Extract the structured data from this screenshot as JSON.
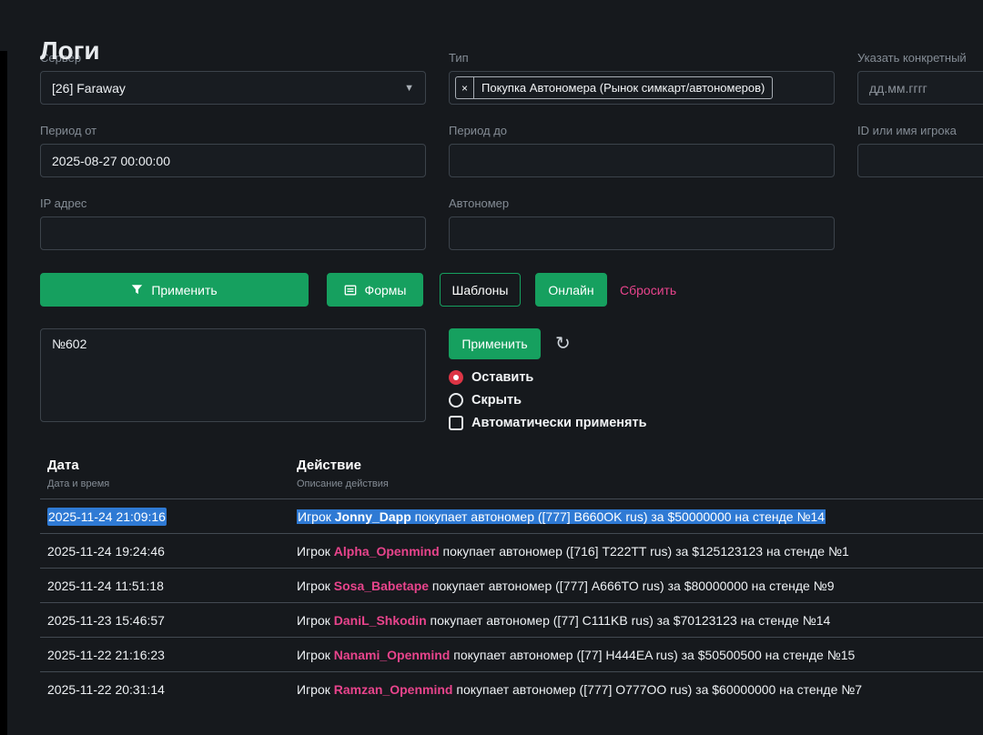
{
  "colors": {
    "accent_green": "#16a05f",
    "accent_pink": "#e8448c",
    "selection_blue": "#2f7ad4",
    "radio_red": "#dd3545"
  },
  "page": {
    "title": "Логи"
  },
  "filters": {
    "server": {
      "label": "Сервер",
      "value": "[26] Faraway"
    },
    "type": {
      "label": "Тип",
      "tag": "Покупка Автономера (Рынок симкарт/автономеров)",
      "tag_remove": "×"
    },
    "specific": {
      "label": "Указать конкретный",
      "placeholder": "дд.мм.гггг"
    },
    "period_from": {
      "label": "Период от",
      "value": "2025-08-27 00:00:00"
    },
    "period_to": {
      "label": "Период до",
      "value": ""
    },
    "player_id": {
      "label": "ID или имя игрока",
      "value": ""
    },
    "ip": {
      "label": "IP адрес",
      "value": ""
    },
    "autonumber": {
      "label": "Автономер",
      "value": ""
    }
  },
  "toolbar": {
    "apply_label": "Применить",
    "forms_label": "Формы",
    "templates_label": "Шаблоны",
    "online_label": "Онлайн",
    "reset_label": "Сбросить"
  },
  "note": {
    "text": "№602",
    "apply_label": "Применить",
    "refresh_icon": "↻",
    "options": [
      {
        "label": "Оставить",
        "type": "radio",
        "checked": true
      },
      {
        "label": "Скрыть",
        "type": "radio",
        "checked": false
      },
      {
        "label": "Автоматически применять",
        "type": "checkbox",
        "checked": false
      }
    ]
  },
  "table": {
    "columns": [
      {
        "title": "Дата",
        "subtitle": "Дата и время"
      },
      {
        "title": "Действие",
        "subtitle": "Описание действия"
      }
    ],
    "rows": [
      {
        "date": "2025-11-24 21:09:16",
        "prefix": "Игрок ",
        "player": "Jonny_Dapp",
        "action": " покупает автономер ([777] B660OK rus) за $50000000 на стенде №14",
        "selected": true
      },
      {
        "date": "2025-11-24 19:24:46",
        "prefix": "Игрок ",
        "player": "Alpha_Openmind",
        "action": " покупает автономер ([716] T222TT rus) за $125123123 на стенде №1"
      },
      {
        "date": "2025-11-24 11:51:18",
        "prefix": "Игрок ",
        "player": "Sosa_Babetape",
        "action": " покупает автономер ([777] A666TO rus) за $80000000 на стенде №9"
      },
      {
        "date": "2025-11-23 15:46:57",
        "prefix": "Игрок ",
        "player": "DaniL_Shkodin",
        "action": " покупает автономер ([77] C111KB rus) за $70123123 на стенде №14"
      },
      {
        "date": "2025-11-22 21:16:23",
        "prefix": "Игрок ",
        "player": "Nanami_Openmind",
        "action": " покупает автономер ([77] H444EA rus) за $50500500 на стенде №15"
      },
      {
        "date": "2025-11-22 20:31:14",
        "prefix": "Игрок ",
        "player": "Ramzan_Openmind",
        "action": " покупает автономер ([777] O777OO rus) за $60000000 на стенде №7",
        "partial": true
      }
    ]
  }
}
